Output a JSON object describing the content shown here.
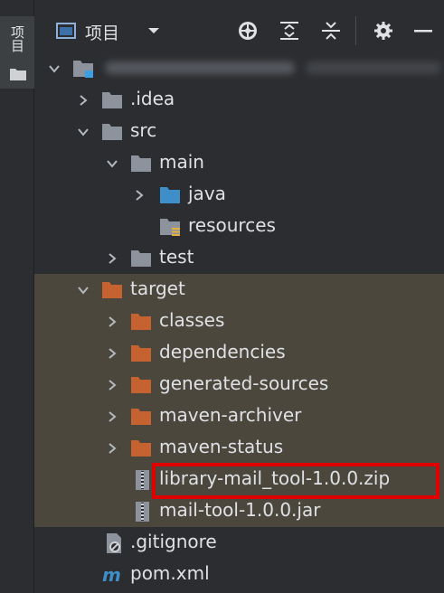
{
  "sidebar": {
    "tab_label": "项目"
  },
  "toolbar": {
    "title": "项目",
    "buttons": [
      "locate-icon",
      "expand-all-icon",
      "collapse-all-icon",
      "settings-icon",
      "hide-icon"
    ]
  },
  "tree": {
    "root": {
      "name": ""
    },
    "items": [
      {
        "label": ".idea"
      },
      {
        "label": "src"
      },
      {
        "label": "main"
      },
      {
        "label": "java"
      },
      {
        "label": "resources"
      },
      {
        "label": "test"
      },
      {
        "label": "target"
      },
      {
        "label": "classes"
      },
      {
        "label": "dependencies"
      },
      {
        "label": "generated-sources"
      },
      {
        "label": "maven-archiver"
      },
      {
        "label": "maven-status"
      },
      {
        "label": "library-mail_tool-1.0.0.zip"
      },
      {
        "label": "mail-tool-1.0.0.jar"
      },
      {
        "label": ".gitignore"
      },
      {
        "label": "pom.xml"
      }
    ]
  },
  "colors": {
    "background": "#2b2d30",
    "target_highlight": "#4b473d",
    "folder_gray": "#8c939c",
    "folder_orange": "#c5622f",
    "folder_blue": "#3d8ec9",
    "selection_box": "#e00000"
  }
}
